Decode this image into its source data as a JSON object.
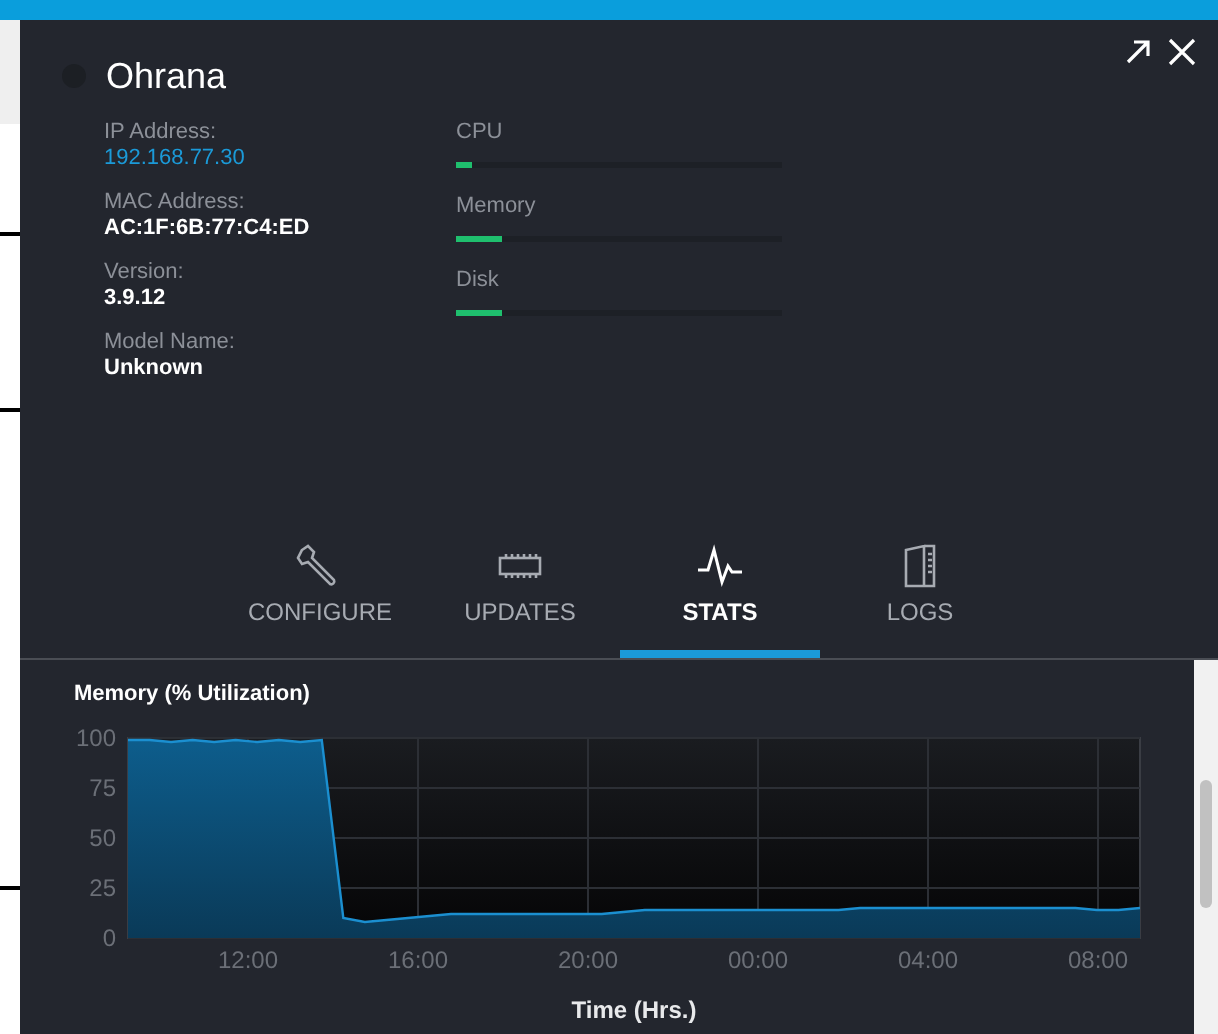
{
  "device": {
    "name": "Ohrana"
  },
  "details": [
    {
      "label": "IP Address:",
      "value": "192.168.77.30",
      "kind": "link"
    },
    {
      "label": "MAC Address:",
      "value": "AC:1F:6B:77:C4:ED",
      "kind": "text"
    },
    {
      "label": "Version:",
      "value": "3.9.12",
      "kind": "text"
    },
    {
      "label": "Model Name:",
      "value": "Unknown",
      "kind": "text"
    }
  ],
  "meters": [
    {
      "label": "CPU",
      "level": 0.05
    },
    {
      "label": "Memory",
      "level": 0.14
    },
    {
      "label": "Disk",
      "level": 0.14
    }
  ],
  "tabs": [
    {
      "label": "CONFIGURE",
      "selected": false
    },
    {
      "label": "UPDATES",
      "selected": false
    },
    {
      "label": "STATS",
      "selected": true
    },
    {
      "label": "LOGS",
      "selected": false
    }
  ],
  "chart": {
    "chart_data": {
      "type": "area",
      "title": "Memory (% Utilization)",
      "xlabel": "Time (Hrs.)",
      "grid": true,
      "series": [
        {
          "color": "#1b8fd0",
          "values": [
            99,
            99,
            98,
            99,
            98,
            99,
            98,
            99,
            98,
            99,
            10,
            8,
            9,
            10,
            11,
            12,
            12,
            12,
            12,
            12,
            12,
            12,
            12,
            13,
            14,
            14,
            14,
            14,
            14,
            14,
            14,
            14,
            14,
            14,
            15,
            15,
            15,
            15,
            15,
            15,
            15,
            15,
            15,
            15,
            15,
            14,
            14,
            15
          ]
        }
      ],
      "ylim": [
        0,
        100
      ],
      "yticks": [
        0,
        25,
        50,
        75,
        100
      ]
    },
    "x_axis_labels": [
      "12:00",
      "16:00",
      "20:00",
      "00:00",
      "04:00",
      "08:00"
    ]
  }
}
